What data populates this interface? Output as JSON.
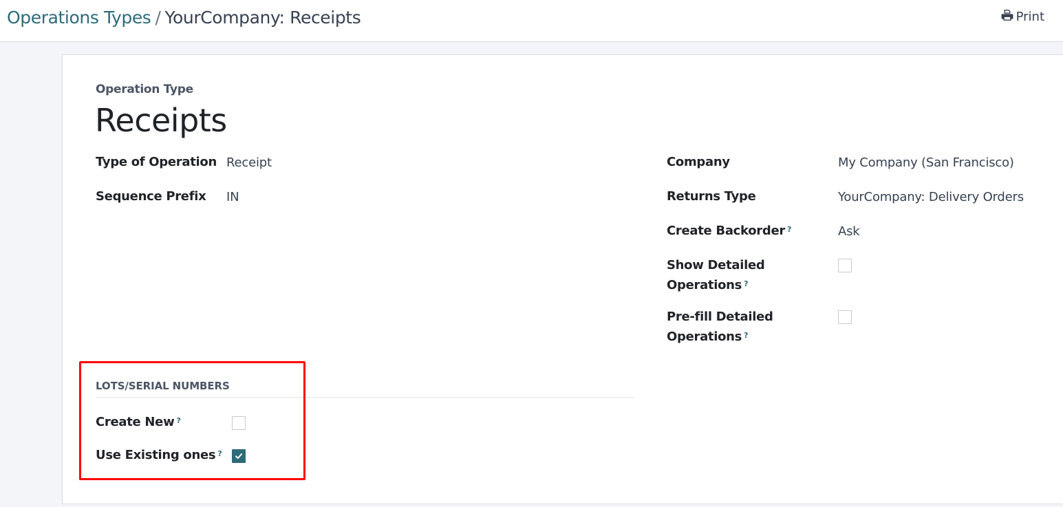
{
  "breadcrumb": {
    "parent": "Operations Types",
    "separator": "/",
    "current": "YourCompany: Receipts"
  },
  "toolbar": {
    "print_label": "Print",
    "print_icon": "printer-icon"
  },
  "form": {
    "subtitle": "Operation Type",
    "title": "Receipts",
    "left_fields": [
      {
        "label": "Type of Operation",
        "value": "Receipt"
      },
      {
        "label": "Sequence Prefix",
        "value": "IN"
      }
    ],
    "right_fields": [
      {
        "label": "Company",
        "value": "My Company (San Francisco)",
        "help": false
      },
      {
        "label": "Returns Type",
        "value": "YourCompany: Delivery Orders",
        "help": false
      },
      {
        "label": "Create Backorder",
        "value": "Ask",
        "help": true
      },
      {
        "label_line1": "Show Detailed",
        "label_line2": "Operations",
        "checked": false,
        "help": true
      },
      {
        "label_line1": "Pre-fill Detailed",
        "label_line2": "Operations",
        "checked": false,
        "help": true
      }
    ],
    "help_marker": "?",
    "lots_section": {
      "title": "LOTS/SERIAL NUMBERS",
      "fields": [
        {
          "label": "Create New",
          "checked": false,
          "help": true
        },
        {
          "label": "Use Existing ones",
          "checked": true,
          "help": true
        }
      ]
    }
  },
  "colors": {
    "accent": "#2e6b78",
    "highlight": "#ff0000"
  }
}
